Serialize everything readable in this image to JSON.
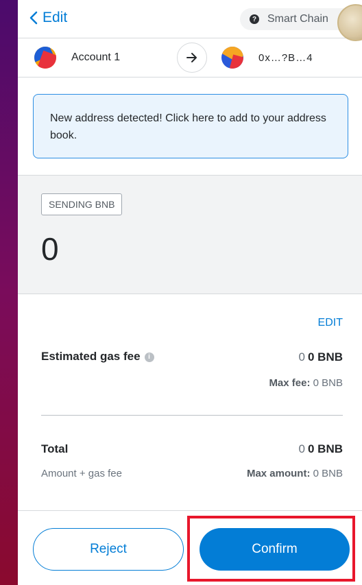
{
  "header": {
    "back_label": "Edit",
    "network_label": "Smart Chain",
    "network_icon": "question-icon"
  },
  "accounts": {
    "from_name": "Account 1",
    "to_address": "0x…?B…4"
  },
  "alert": {
    "message": "New address detected! Click here to add to your address book."
  },
  "sending": {
    "tag": "SENDING BNB",
    "amount": "0"
  },
  "fee": {
    "edit_label": "EDIT",
    "gas_label": "Estimated gas fee",
    "gas_fiat": "0",
    "gas_value": "0 BNB",
    "max_fee_label": "Max fee:",
    "max_fee_value": "0 BNB"
  },
  "total": {
    "label": "Total",
    "fiat": "0",
    "value": "0 BNB",
    "sub_label": "Amount + gas fee",
    "max_amount_label": "Max amount:",
    "max_amount_value": "0 BNB"
  },
  "buttons": {
    "reject": "Reject",
    "confirm": "Confirm"
  },
  "colors": {
    "accent": "#037dd6",
    "highlight": "#e8172c"
  }
}
